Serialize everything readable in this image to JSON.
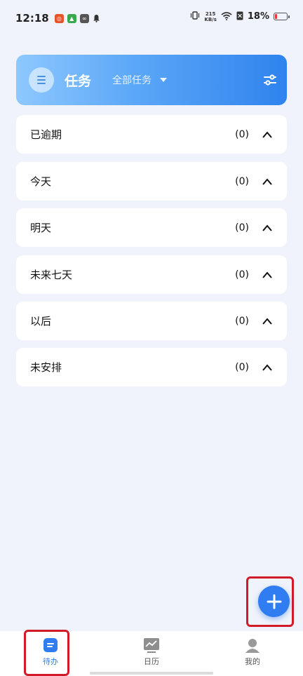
{
  "status_bar": {
    "time": "12:18",
    "net_speed_value": "215",
    "net_speed_unit": "KB/s",
    "battery_text": "18%",
    "battery_level": 0.18,
    "battery_color": "#e53935"
  },
  "header": {
    "title": "任务",
    "filter_label": "全部任务"
  },
  "sections": [
    {
      "label": "已逾期",
      "count": "(0)"
    },
    {
      "label": "今天",
      "count": "(0)"
    },
    {
      "label": "明天",
      "count": "(0)"
    },
    {
      "label": "未来七天",
      "count": "(0)"
    },
    {
      "label": "以后",
      "count": "(0)"
    },
    {
      "label": "未安排",
      "count": "(0)"
    }
  ],
  "bottom_nav": {
    "items": [
      {
        "label": "待办",
        "icon": "todo-icon",
        "active": true
      },
      {
        "label": "日历",
        "icon": "chart-icon",
        "active": false
      },
      {
        "label": "我的",
        "icon": "profile-icon",
        "active": false
      }
    ]
  },
  "colors": {
    "accent": "#2f7df0",
    "highlight": "#d11a2a",
    "background": "#f0f3fb"
  }
}
